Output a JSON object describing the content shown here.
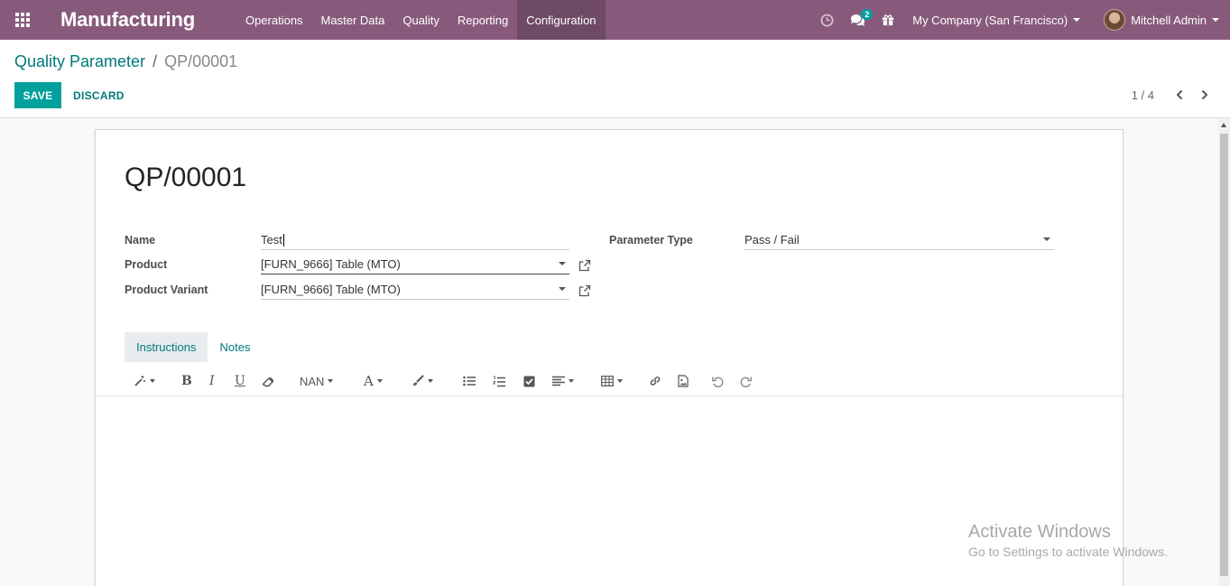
{
  "navbar": {
    "app_name": "Manufacturing",
    "menu": [
      "Operations",
      "Master Data",
      "Quality",
      "Reporting",
      "Configuration"
    ],
    "active_menu": "Configuration",
    "messages_badge": "2",
    "company": "My Company (San Francisco)",
    "user": "Mitchell Admin",
    "icons": [
      "apps-grid-icon",
      "clock-icon",
      "chat-icon",
      "gift-icon"
    ]
  },
  "breadcrumb": {
    "parent": "Quality Parameter",
    "separator": "/",
    "current": "QP/00001"
  },
  "actions": {
    "save": "SAVE",
    "discard": "DISCARD"
  },
  "pager": {
    "value": "1 / 4"
  },
  "form": {
    "title": "QP/00001",
    "name_label": "Name",
    "name_value": "Test",
    "product_label": "Product",
    "product_value": "[FURN_9666] Table (MTO)",
    "variant_label": "Product Variant",
    "variant_value": "[FURN_9666] Table (MTO)",
    "parameter_type_label": "Parameter Type",
    "parameter_type_value": "Pass / Fail"
  },
  "tabs": [
    {
      "label": "Instructions",
      "active": true
    },
    {
      "label": "Notes",
      "active": false
    }
  ],
  "editor_toolbar": {
    "font_size_label": "NAN",
    "font_color_label": "A",
    "bold": "B",
    "italic": "I",
    "underline": "U"
  },
  "watermark": {
    "line1": "Activate Windows",
    "line2": "Go to Settings to activate Windows."
  },
  "colors": {
    "navbar": "#875a7b",
    "primary": "#00a09d",
    "link": "#00797a"
  }
}
